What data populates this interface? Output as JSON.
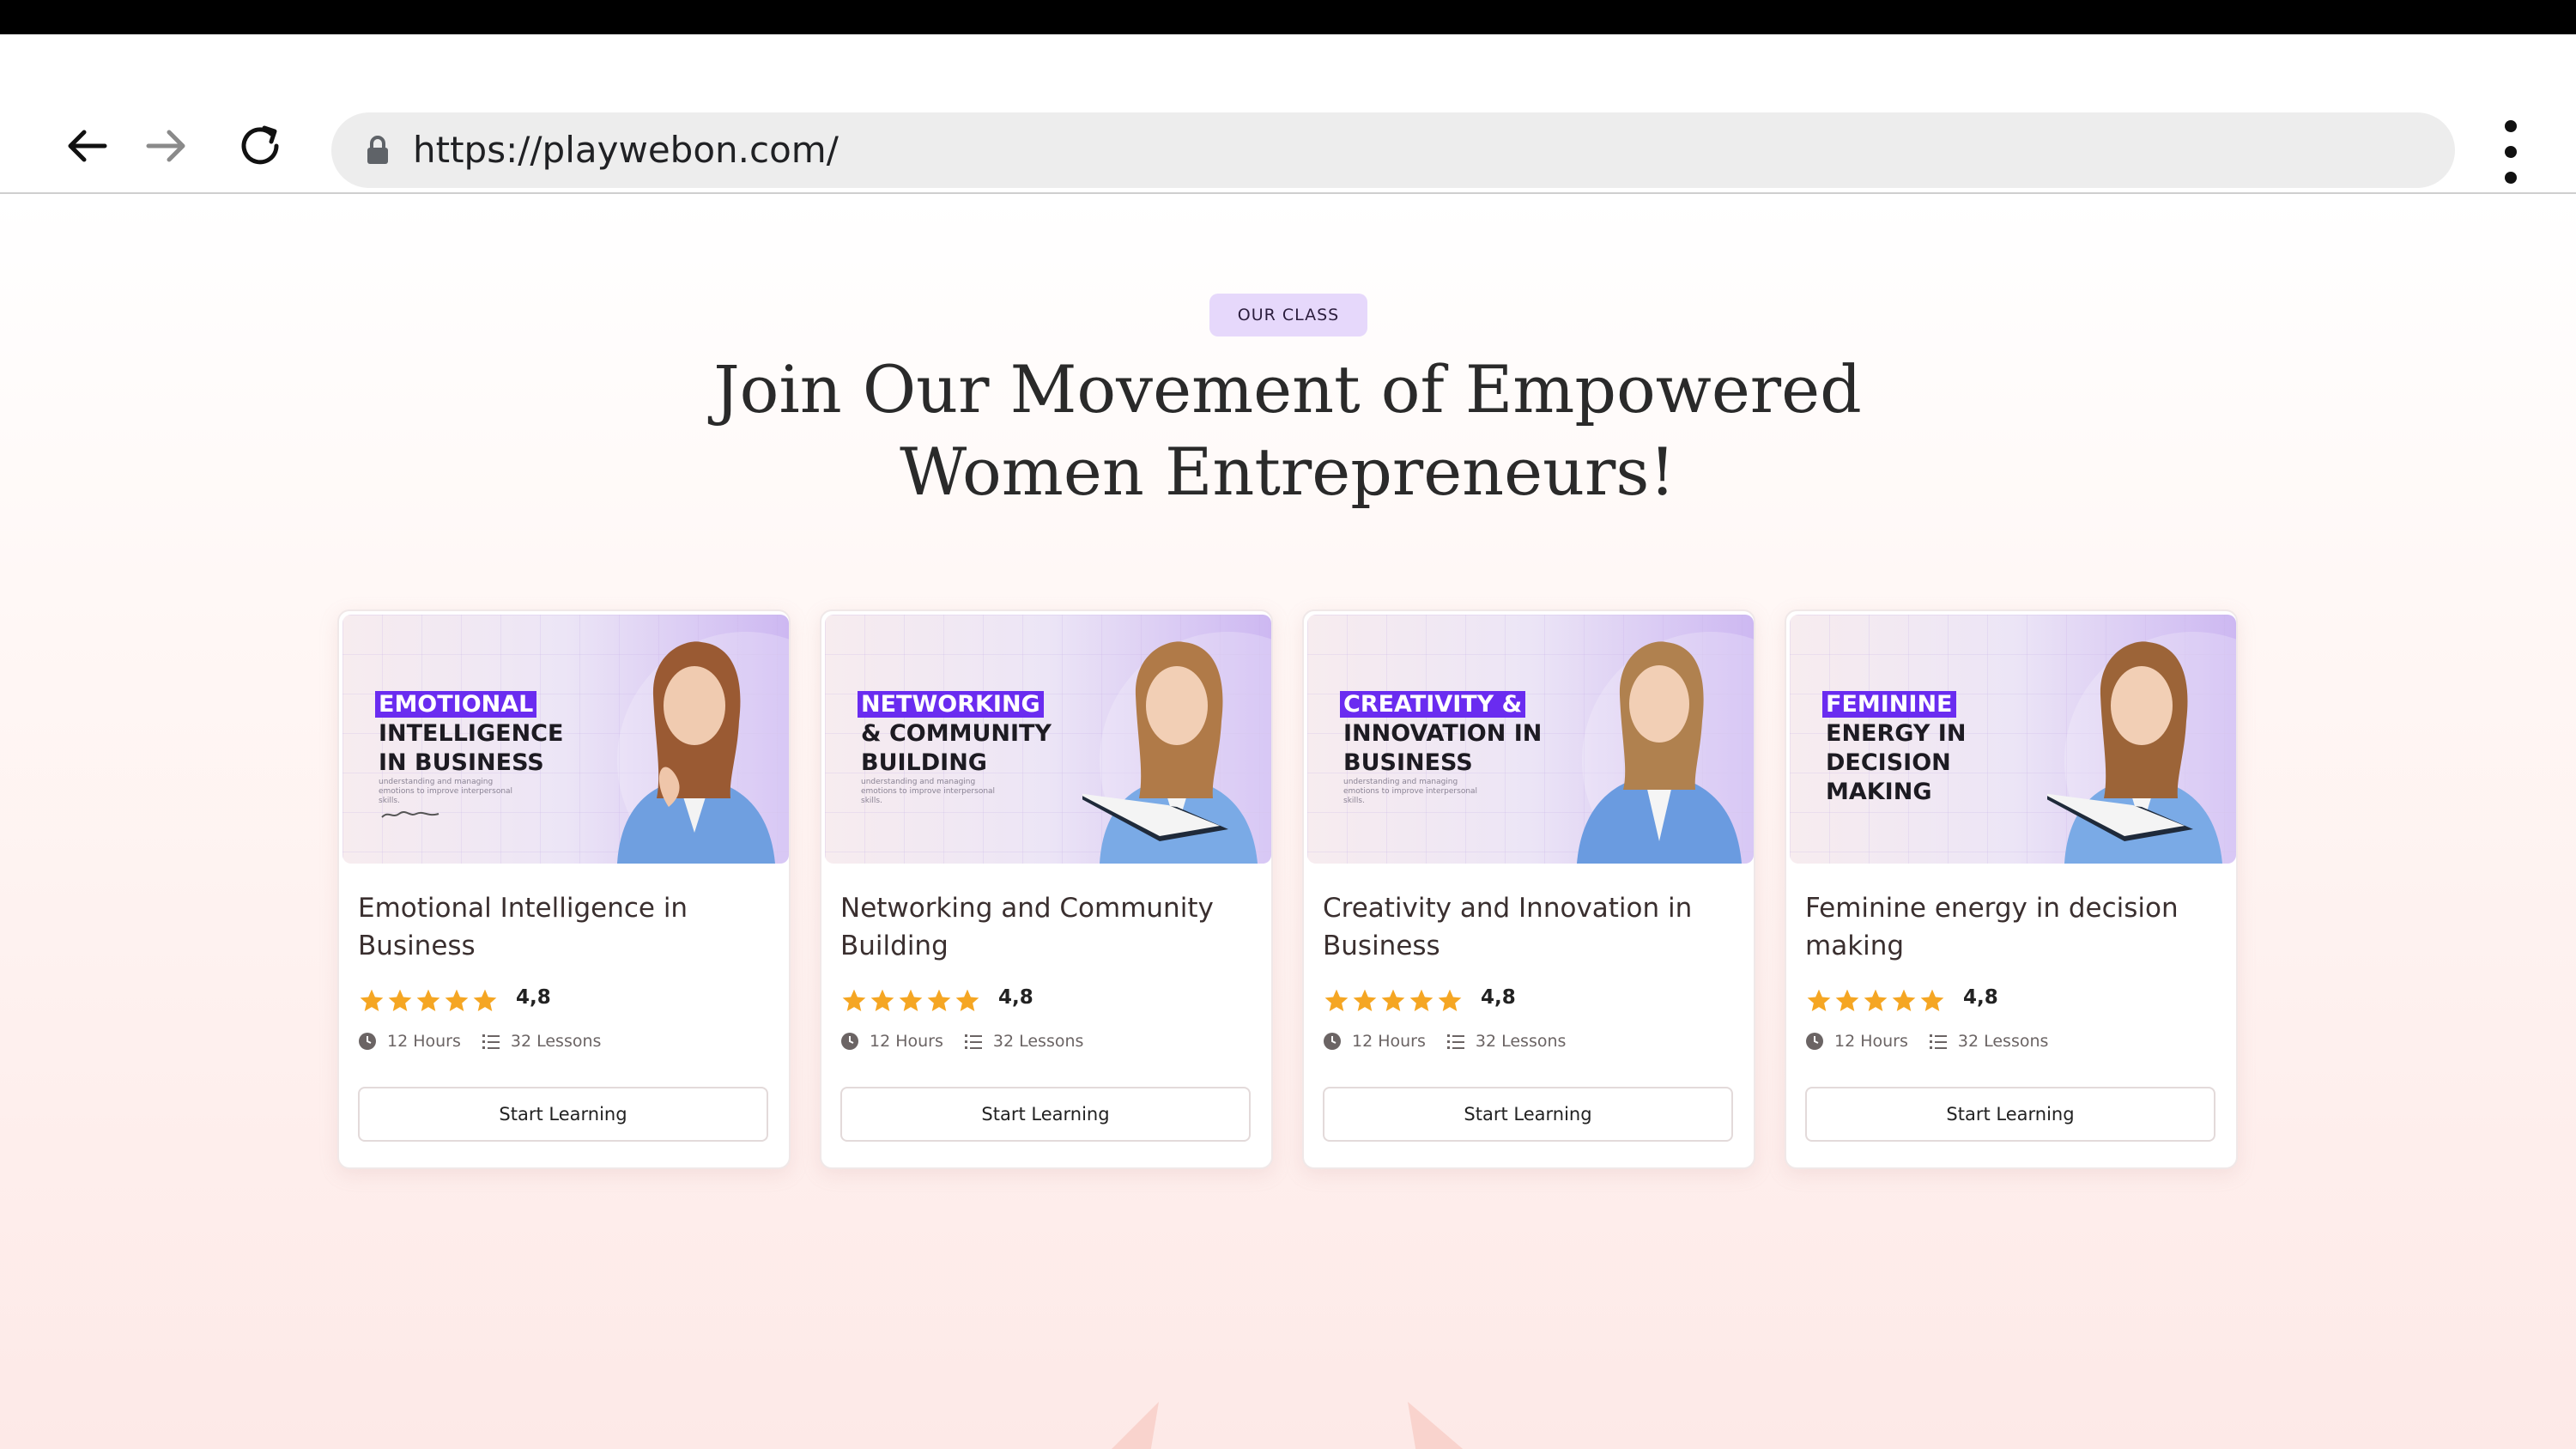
{
  "browser": {
    "url": "https://playwebon.com/"
  },
  "section": {
    "badge": "OUR CLASS",
    "heading_line1": "Join Our Movement of Empowered",
    "heading_line2": "Women Entrepreneurs!"
  },
  "colors": {
    "accent": "#6a2cf0",
    "star": "#f5a623",
    "badge_bg": "#e6d8fb"
  },
  "courses": [
    {
      "thumb_lines": [
        "EMOTIONAL",
        "INTELLIGENCE",
        "IN BUSINESS"
      ],
      "thumb_sub": "understanding and managing emotions to improve interpersonal skills.",
      "title": "Emotional Intelligence in Business",
      "rating": "4,8",
      "stars": 5,
      "hours": "12 Hours",
      "lessons": "32 Lessons",
      "button": "Start Learning"
    },
    {
      "thumb_lines": [
        "NETWORKING",
        "& COMMUNITY",
        "BUILDING"
      ],
      "thumb_sub": "understanding and managing emotions to improve interpersonal skills.",
      "title": "Networking and Community Building",
      "rating": "4,8",
      "stars": 5,
      "hours": "12 Hours",
      "lessons": "32 Lessons",
      "button": "Start Learning"
    },
    {
      "thumb_lines": [
        "CREATIVITY &",
        "INNOVATION IN",
        "BUSINESS"
      ],
      "thumb_sub": "understanding and managing emotions to improve interpersonal skills.",
      "title": "Creativity and Innovation in Business",
      "rating": "4,8",
      "stars": 5,
      "hours": "12 Hours",
      "lessons": "32 Lessons",
      "button": "Start Learning"
    },
    {
      "thumb_lines": [
        "FEMININE",
        "ENERGY IN",
        "DECISION",
        "MAKING"
      ],
      "thumb_sub": "",
      "title": "Feminine energy in decision making",
      "rating": "4,8",
      "stars": 5,
      "hours": "12 Hours",
      "lessons": "32 Lessons",
      "button": "Start Learning"
    }
  ]
}
